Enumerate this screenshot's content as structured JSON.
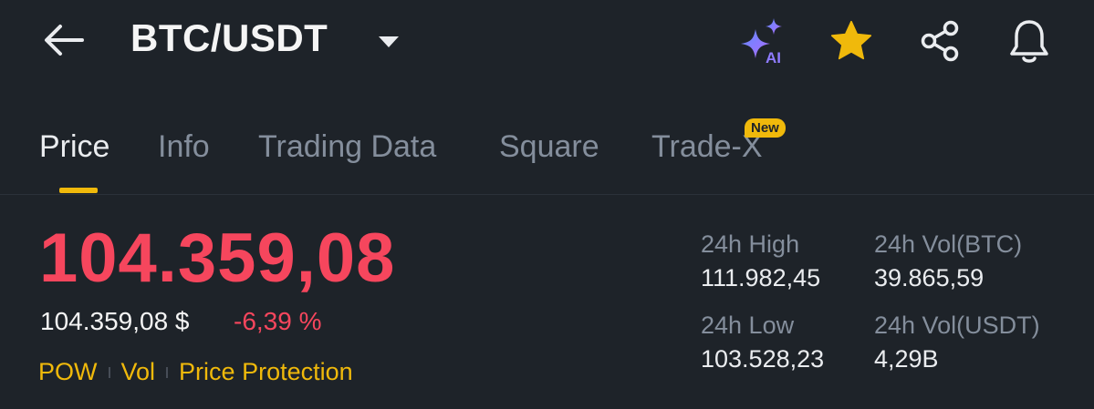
{
  "header": {
    "pair": "BTC/USDT",
    "ai_label": "AI"
  },
  "tabs": [
    {
      "label": "Price",
      "active": true
    },
    {
      "label": "Info"
    },
    {
      "label": "Trading Data"
    },
    {
      "label": "Square"
    },
    {
      "label": "Trade-X",
      "badge": "New"
    }
  ],
  "ticker": {
    "last_price": "104.359,08",
    "usd_price": "104.359,08 $",
    "change_pct": "-6,39 %",
    "tags": [
      "POW",
      "Vol",
      "Price Protection"
    ]
  },
  "stats": {
    "high_label": "24h High",
    "high_value": "111.982,45",
    "low_label": "24h Low",
    "low_value": "103.528,23",
    "vol_base_label": "24h Vol(BTC)",
    "vol_base_value": "39.865,59",
    "vol_quote_label": "24h Vol(USDT)",
    "vol_quote_value": "4,29B"
  },
  "colors": {
    "background": "#1e2329",
    "accent": "#f0b90b",
    "down": "#f6465d",
    "muted": "#848e9c",
    "ai_gradient": [
      "#5b8cff",
      "#b26bff"
    ]
  },
  "icons": [
    "back-arrow-icon",
    "caret-down-icon",
    "ai-sparkle-icon",
    "star-icon",
    "share-icon",
    "bell-icon"
  ]
}
